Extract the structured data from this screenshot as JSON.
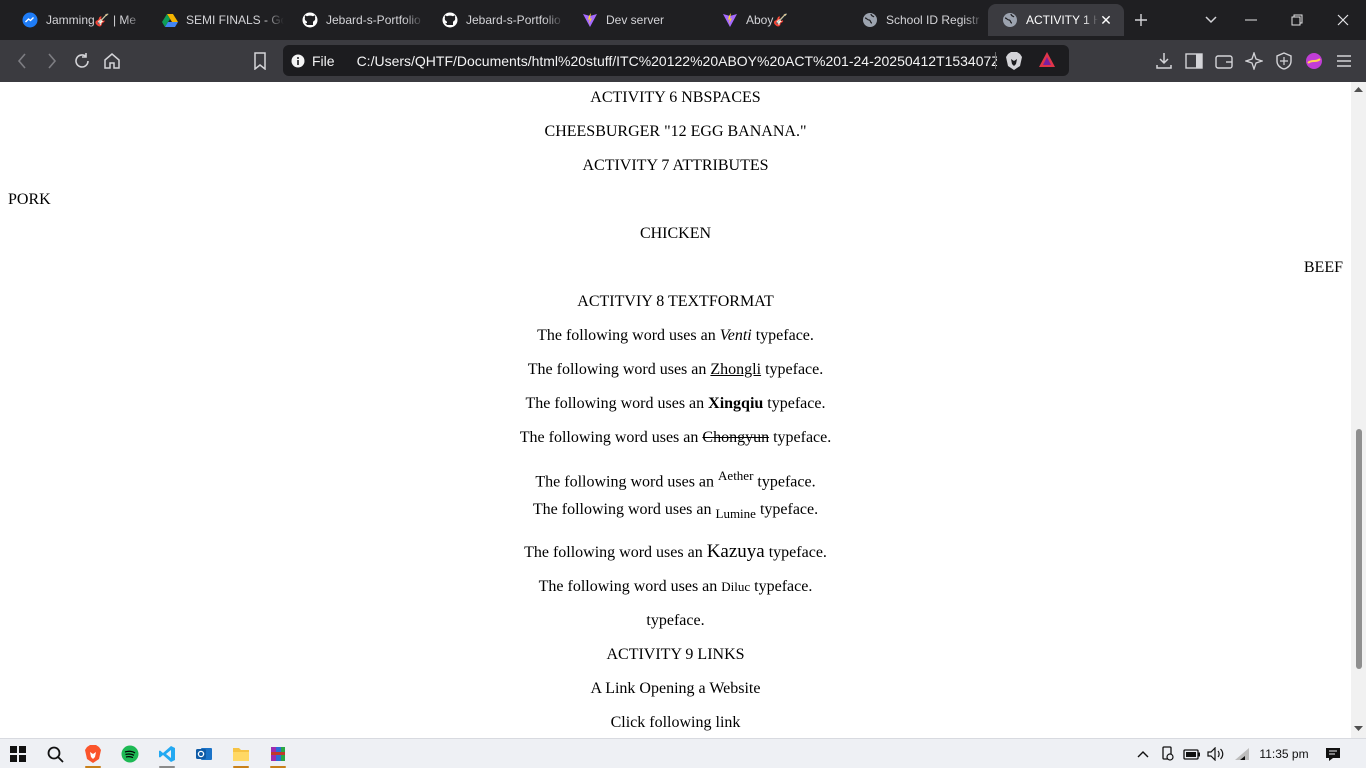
{
  "browser": {
    "tabs": [
      {
        "label": "Jamming🎸 | Me",
        "icon": "messenger-icon",
        "color": "#1e7cf7"
      },
      {
        "label": "SEMI FINALS - Go",
        "icon": "drive-icon",
        "color": "#f4b400"
      },
      {
        "label": "Jebard-s-Portfolio",
        "icon": "github-icon",
        "color": "#ffffff"
      },
      {
        "label": "Jebard-s-Portfolio",
        "icon": "github-icon",
        "color": "#ffffff"
      },
      {
        "label": "Dev server",
        "icon": "vite-icon",
        "color": "#a66bff"
      },
      {
        "label": "Aboy🎸",
        "icon": "vite-icon",
        "color": "#a66bff"
      },
      {
        "label": "School ID Registr",
        "icon": "globe-icon",
        "color": "#9ca3af"
      },
      {
        "label": "ACTIVITY 1 H",
        "icon": "globe-icon",
        "color": "#9ca3af",
        "active": true
      }
    ],
    "url_scheme": "File",
    "url": "C:/Users/QHTF/Documents/html%20stuff/ITC%20122%20ABOY%20ACT%201-24-20250412T153407Z..."
  },
  "page": {
    "lines": [
      {
        "text": "ACTIVITY 6 NBSPACES",
        "align": "center"
      },
      {
        "text": "CHEESBURGER \"12 EGG BANANA.\"",
        "align": "center"
      },
      {
        "text": "ACTIVITY 7 ATTRIBUTES",
        "align": "center"
      },
      {
        "text": "PORK",
        "align": "left"
      },
      {
        "text": "CHICKEN",
        "align": "center"
      },
      {
        "text": "BEEF",
        "align": "right"
      },
      {
        "text": "ACTITVIY 8 TEXTFORMAT",
        "align": "center"
      }
    ],
    "format_prefix": "The following word uses an ",
    "format_suffix": " typeface.",
    "format_words": [
      {
        "word": "Venti",
        "style": "italic"
      },
      {
        "word": "Zhongli",
        "style": "underline"
      },
      {
        "word": "Xingqiu",
        "style": "bold"
      },
      {
        "word": "Chongyun",
        "style": "strikethrough"
      },
      {
        "word": "Aether",
        "style": "superscript"
      },
      {
        "word": "Lumine",
        "style": "subscript"
      },
      {
        "word": "Kazuya",
        "style": "big"
      },
      {
        "word": "Diluc",
        "style": "small"
      }
    ],
    "trailing": "typeface.",
    "activity9": "ACTIVITY 9 LINKS",
    "link_heading": "A Link Opening a Website",
    "click_text": "Click following link"
  },
  "taskbar": {
    "time": "11:35 pm",
    "apps": [
      "windows-start-icon",
      "search-icon",
      "brave-icon",
      "spotify-icon",
      "vscode-icon",
      "outlook-icon",
      "file-explorer-icon",
      "winrar-icon"
    ]
  }
}
